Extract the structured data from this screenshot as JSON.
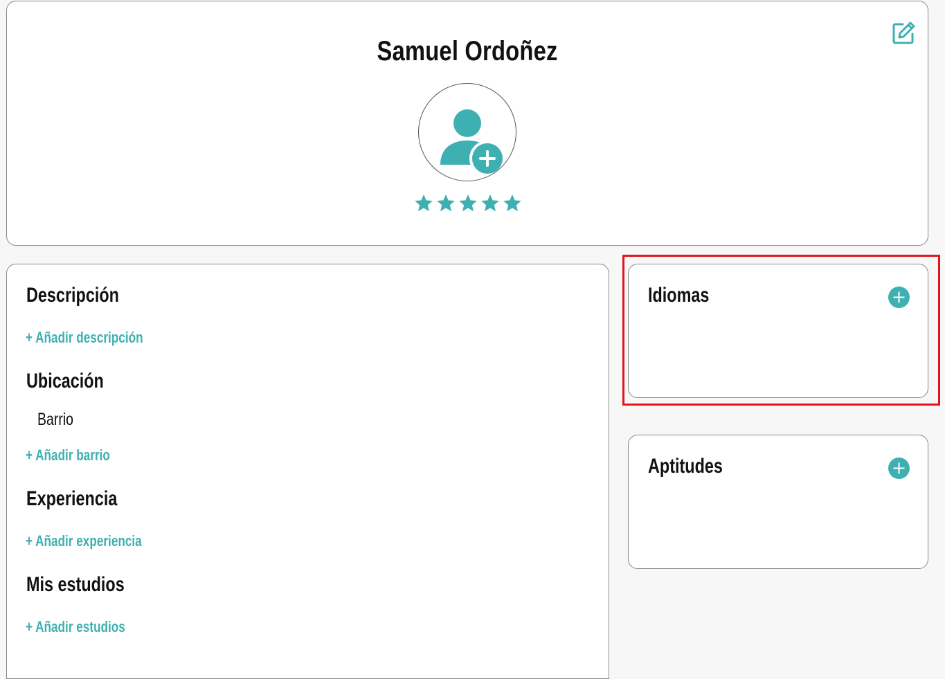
{
  "profile": {
    "name": "Samuel Ordoñez",
    "rating": 5,
    "rating_max": 5,
    "edit_icon": "edit-icon",
    "avatar_icon": "add-user-icon",
    "star_icon": "star-icon"
  },
  "main": {
    "descripcion": {
      "title": "Descripción",
      "add_label": "+ Añadir descripción"
    },
    "ubicacion": {
      "title": "Ubicación",
      "field_label": "Barrio",
      "add_label": "+ Añadir barrio"
    },
    "experiencia": {
      "title": "Experiencia",
      "add_label": "+ Añadir experiencia"
    },
    "estudios": {
      "title": "Mis estudios",
      "add_label": "+ Añadir estudios"
    }
  },
  "side": {
    "idiomas": {
      "title": "Idiomas",
      "add_icon": "plus-circle-icon"
    },
    "aptitudes": {
      "title": "Aptitudes",
      "add_icon": "plus-circle-icon"
    }
  },
  "colors": {
    "accent": "#3fb0b1",
    "highlight": "#e3151a",
    "background": "#f7f7f7",
    "card": "#ffffff"
  }
}
